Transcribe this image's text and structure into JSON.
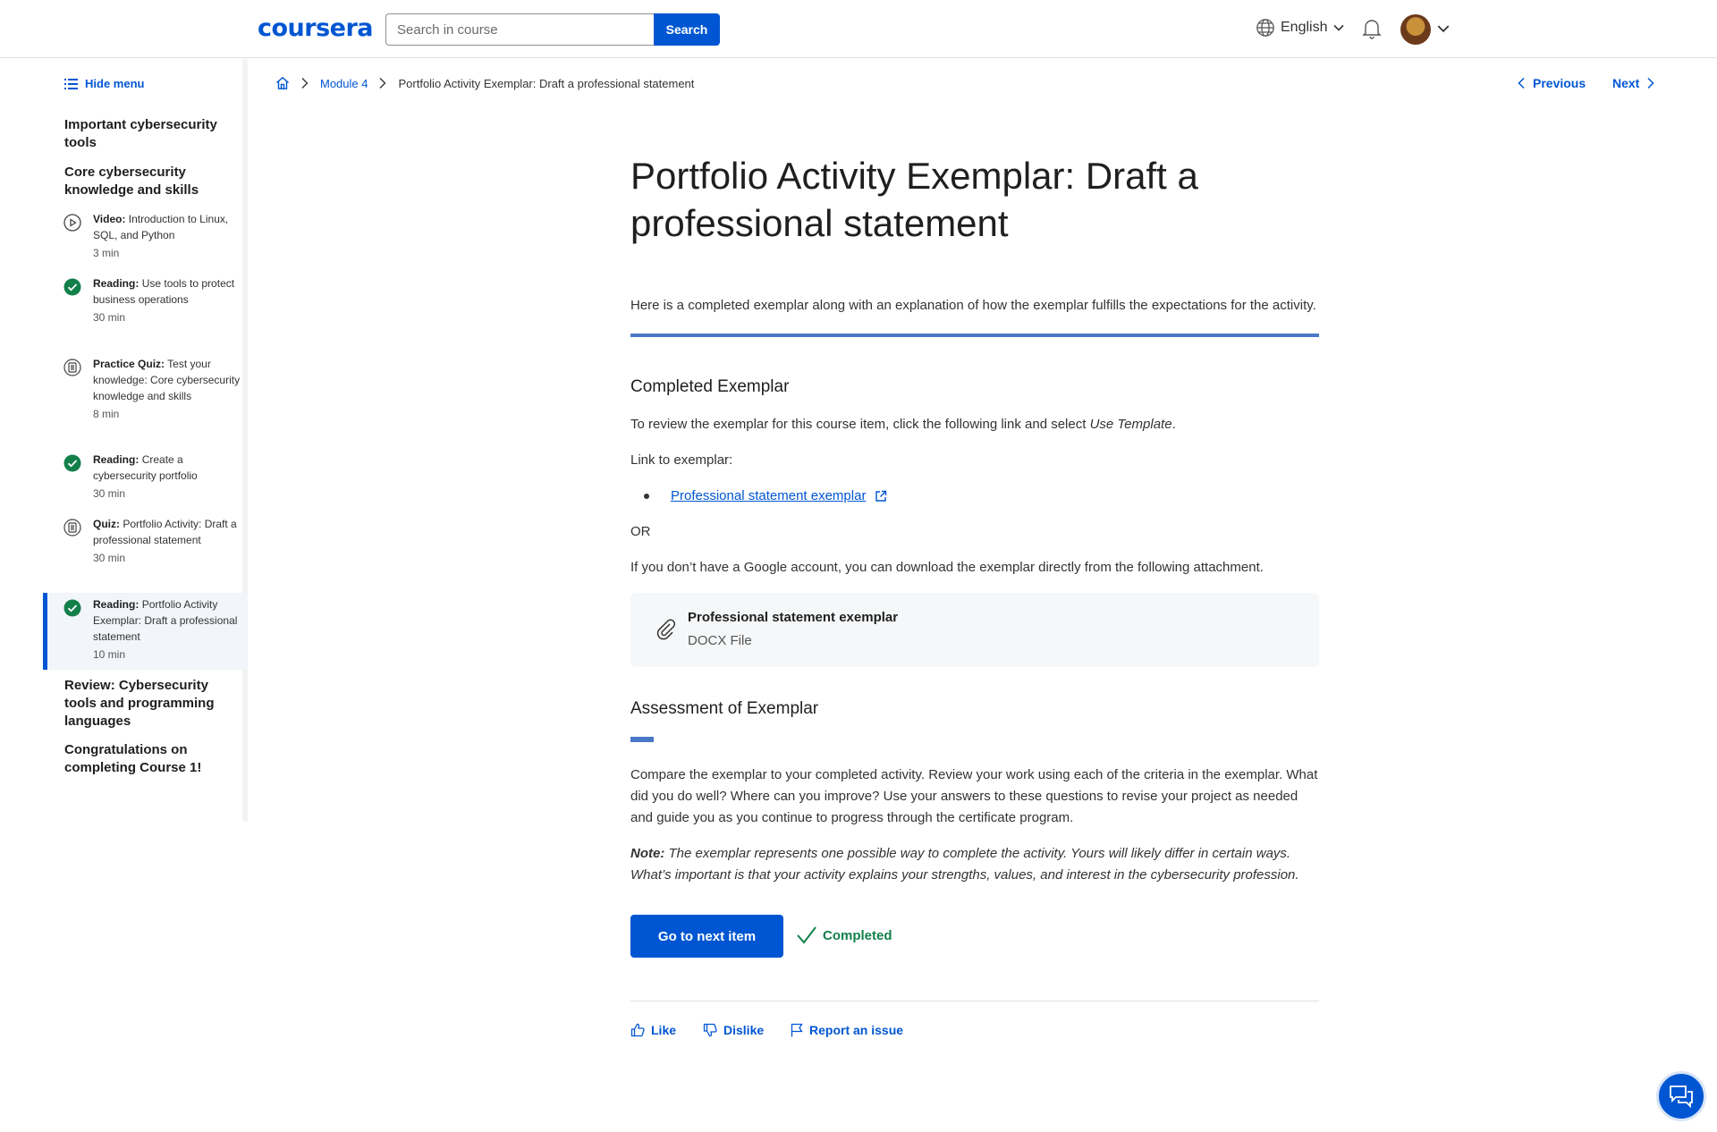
{
  "header": {
    "logo": "coursera",
    "search_placeholder": "Search in course",
    "search_button": "Search",
    "language": "English"
  },
  "sidebar": {
    "hide_menu": "Hide menu",
    "sections_before": [
      "Important cybersecurity tools",
      "Core cybersecurity knowledge and skills"
    ],
    "items": [
      {
        "type": "Video:",
        "title": "Introduction to Linux, SQL, and Python",
        "duration": "3 min",
        "icon": "play-icon",
        "status": "not-started"
      },
      {
        "type": "Reading:",
        "title": "Use tools to protect business operations",
        "duration": "30 min",
        "icon": "check-circle-icon",
        "status": "completed"
      },
      {
        "type": "Practice Quiz:",
        "title": "Test your knowledge: Core cybersecurity knowledge and skills",
        "duration": "8 min",
        "icon": "quiz-icon",
        "status": "not-started"
      },
      {
        "type": "Reading:",
        "title": "Create a cybersecurity portfolio",
        "duration": "30 min",
        "icon": "check-circle-icon",
        "status": "completed"
      },
      {
        "type": "Quiz:",
        "title": "Portfolio Activity: Draft a professional statement",
        "duration": "30 min",
        "icon": "quiz-icon",
        "status": "not-started"
      },
      {
        "type": "Reading:",
        "title": "Portfolio Activity Exemplar: Draft a professional statement",
        "duration": "10 min",
        "icon": "check-circle-icon",
        "status": "completed"
      }
    ],
    "sections_after": [
      "Review: Cybersecurity tools and programming languages",
      "Congratulations on completing Course 1!"
    ]
  },
  "breadcrumb": {
    "module": "Module 4",
    "current": "Portfolio Activity Exemplar: Draft a professional statement"
  },
  "pager": {
    "previous": "Previous",
    "next": "Next"
  },
  "main": {
    "title": "Portfolio Activity Exemplar: Draft a professional statement",
    "intro": "Here is a completed exemplar along with an explanation of how the exemplar fulfills the expectations for the activity.",
    "completed_heading": "Completed Exemplar",
    "review_text": "To review the exemplar for this course item, click the following link and select ",
    "review_text_em": "Use Template",
    "review_text_end": ".",
    "link_label": "Link to exemplar:",
    "exemplar_link": "Professional statement exemplar",
    "or": "OR",
    "download_text": "If you don’t have a Google account, you can download the exemplar directly from the following attachment.",
    "attachment_name": "Professional statement exemplar",
    "attachment_type": "DOCX File",
    "assessment_heading": "Assessment of Exemplar",
    "assessment_text": "Compare the exemplar to your completed activity. Review your work using each of the criteria in the exemplar. What did you do well? Where can you improve? Use your answers to these questions to revise your project as needed and guide you as you continue to progress through the certificate program.",
    "note_label": "Note:",
    "note_text": " The exemplar represents one possible way to complete the activity. Yours will likely differ in certain ways. What’s important is that your activity explains your strengths, values, and interest in the cybersecurity profession.",
    "next_button": "Go to next item",
    "completed_status": "Completed",
    "like": "Like",
    "dislike": "Dislike",
    "report": "Report an issue"
  },
  "colors": {
    "brand": "#0056d2",
    "success": "#13804a",
    "accent_rule": "#4a78c8"
  }
}
